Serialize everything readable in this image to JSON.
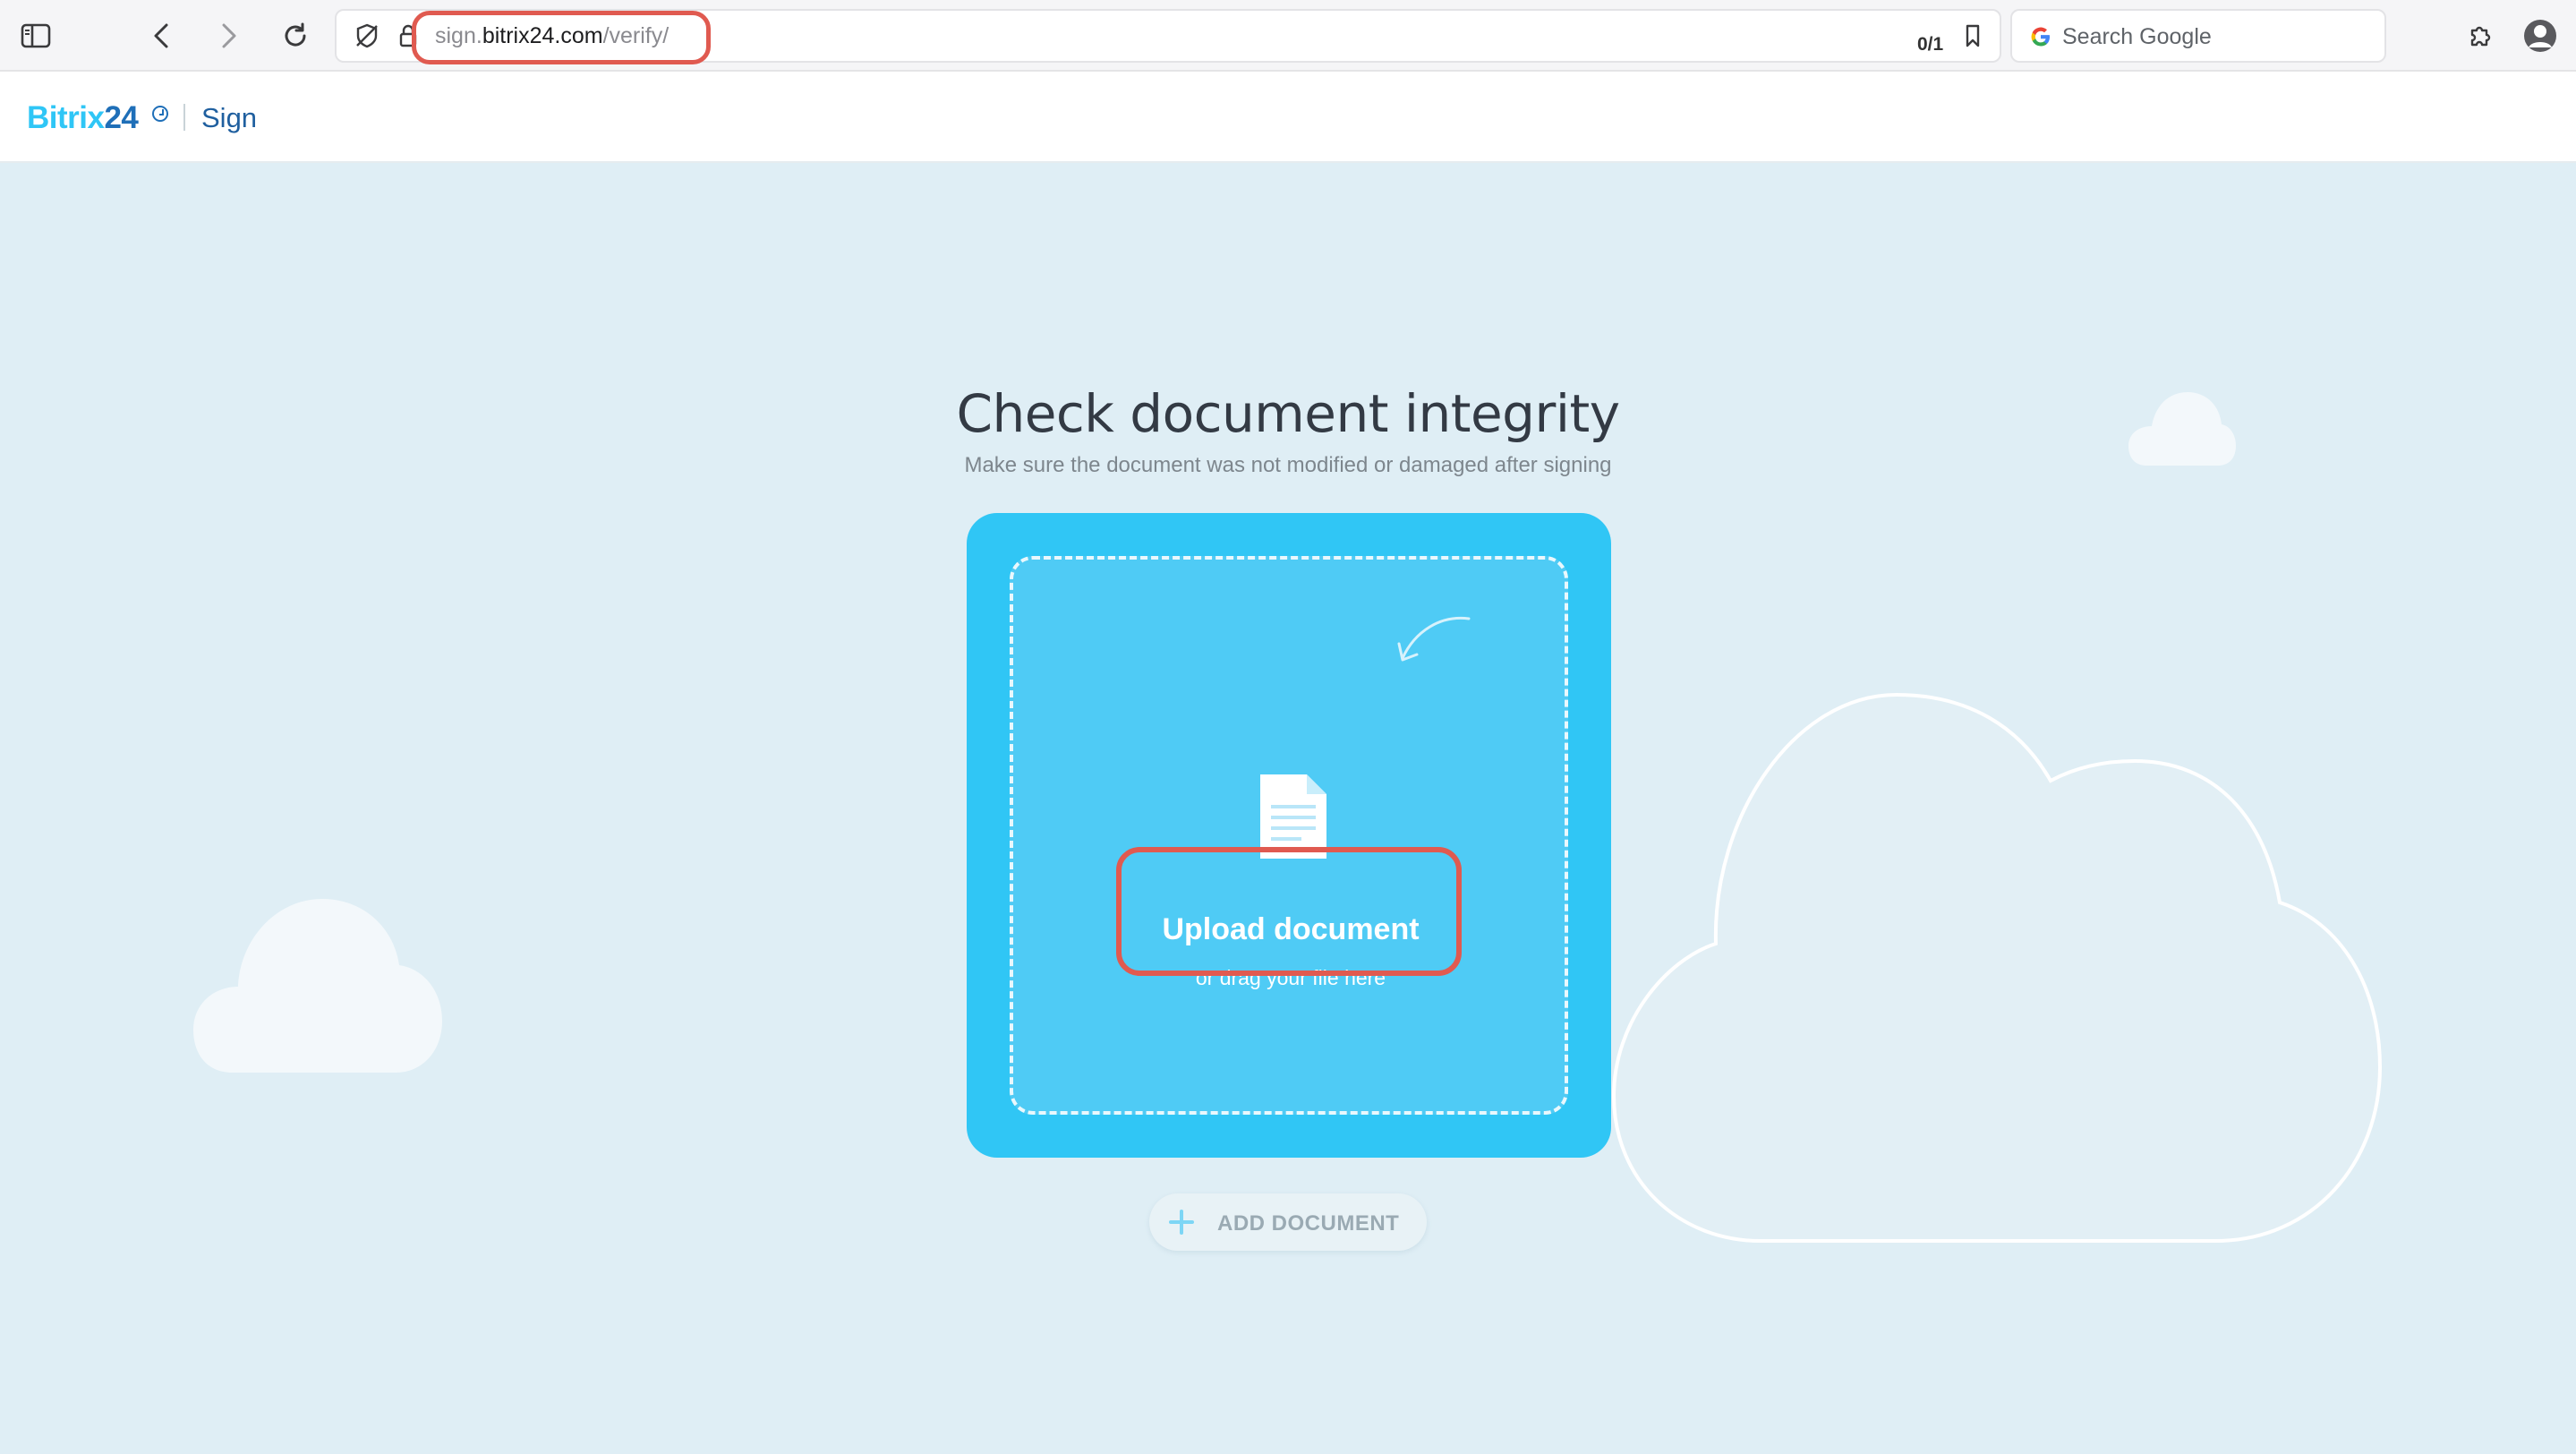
{
  "browser": {
    "url_prefix": "sign.",
    "url_host": "bitrix24.com",
    "url_path": "/verify/",
    "find_counter": "0/1",
    "search_placeholder": "Search Google"
  },
  "header": {
    "logo_text": "Bitrix",
    "logo_number": "24",
    "product": "Sign"
  },
  "main": {
    "title": "Check document integrity",
    "subtitle": "Make sure the document was not modified or damaged after signing",
    "upload_title": "Upload document",
    "upload_subtitle": "or drag your file here",
    "add_document": "ADD DOCUMENT"
  },
  "colors": {
    "accent": "#2fc6f6",
    "card": "#30c6f5",
    "dropzone": "#4fcbf5",
    "highlight": "#e05a50",
    "page_bg": "#dfeef5"
  },
  "icons": [
    "sidebar-icon",
    "back-icon",
    "forward-icon",
    "reload-icon",
    "tracking-shield-icon",
    "lock-icon",
    "bookmark-icon",
    "google-icon",
    "extensions-icon",
    "profile-icon",
    "document-icon",
    "curved-arrow-icon",
    "plus-icon",
    "cloud-icon"
  ]
}
